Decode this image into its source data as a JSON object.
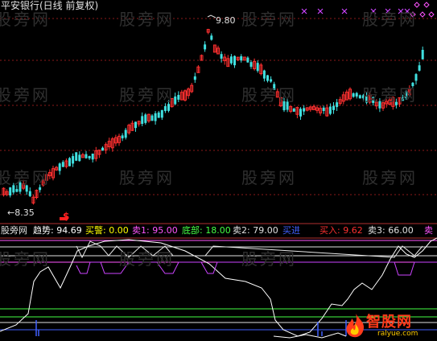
{
  "header": {
    "title": "平安银行(日线 前复权)"
  },
  "price_chart": {
    "high_label": "9.80",
    "low_label": "8.35",
    "signal_glyph": "$"
  },
  "indicator": {
    "name": "股旁网",
    "items": [
      {
        "label": "趋势",
        "value": "94.69",
        "color": "#ffffff"
      },
      {
        "label": "买警",
        "value": "0.00",
        "color": "#ffff00"
      },
      {
        "label": "卖1",
        "value": "95.00",
        "color": "#ff55ff"
      },
      {
        "label": "底部",
        "value": "18.00",
        "color": "#44ff44"
      },
      {
        "label": "卖2",
        "value": "79.00",
        "color": "#e0e0e0"
      },
      {
        "label": "买进",
        "value": "",
        "color": "#4060ff"
      },
      {
        "label": "买入",
        "value": "9.62",
        "color": "#ff3030"
      },
      {
        "label": "卖3",
        "value": "66.00",
        "color": "#e0e0e0"
      },
      {
        "label": "卖",
        "value": "",
        "color": "#ff55ff"
      }
    ]
  },
  "watermarks": [
    "股旁网",
    "股旁网",
    "股旁网",
    "股旁网",
    "股旁网",
    "股旁网",
    "股旁网",
    "股旁网",
    "股旁网",
    "股旁网",
    "股旁网",
    "股旁网",
    "股旁网",
    "股旁网",
    "股旁网"
  ],
  "brand": {
    "name": "智股网",
    "url": "ralyue.com"
  },
  "colors": {
    "up": "#ff3030",
    "down": "#40e0e0",
    "grid": "#8b1a1a",
    "divider": "#b03030"
  }
}
